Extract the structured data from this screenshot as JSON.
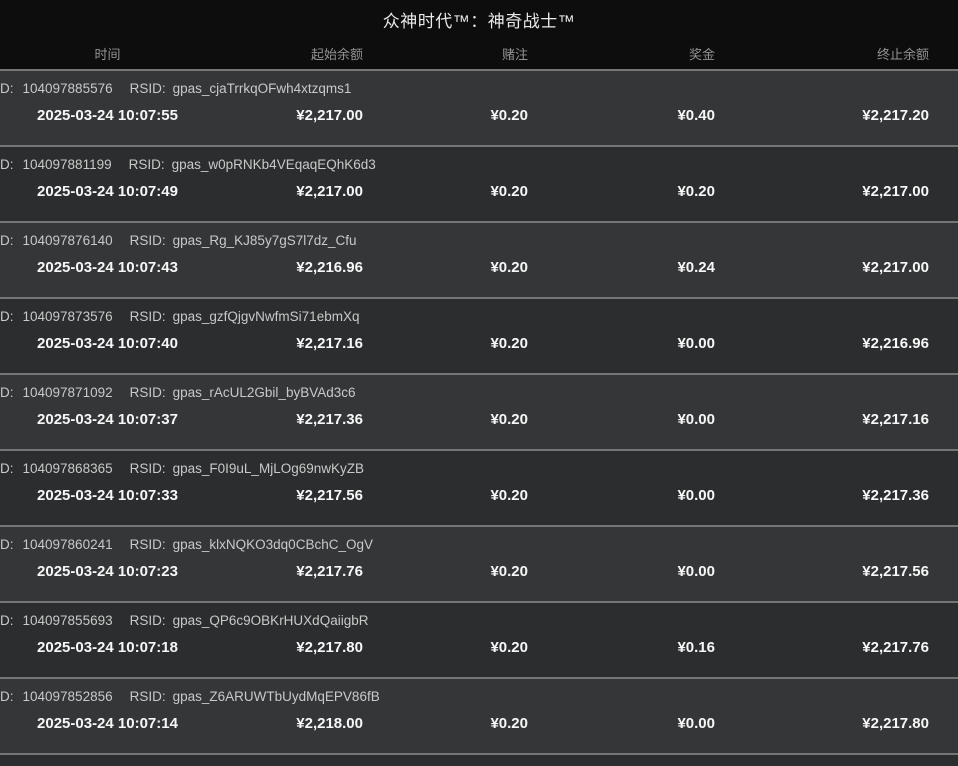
{
  "header": {
    "title": "众神时代™：神奇战士™",
    "columns": {
      "time": "时间",
      "start_balance": "起始余额",
      "bet": "赌注",
      "win": "奖金",
      "end_balance": "终止余额"
    }
  },
  "labels": {
    "id": "D:",
    "rsid": "RSID:"
  },
  "rows": [
    {
      "id": "104097885576",
      "rsid": "gpas_cjaTrrkqOFwh4xtzqms1",
      "time": "2025-03-24 10:07:55",
      "start": "¥2,217.00",
      "bet": "¥0.20",
      "win": "¥0.40",
      "end": "¥2,217.20"
    },
    {
      "id": "104097881199",
      "rsid": "gpas_w0pRNKb4VEqaqEQhK6d3",
      "time": "2025-03-24 10:07:49",
      "start": "¥2,217.00",
      "bet": "¥0.20",
      "win": "¥0.20",
      "end": "¥2,217.00"
    },
    {
      "id": "104097876140",
      "rsid": "gpas_Rg_KJ85y7gS7l7dz_Cfu",
      "time": "2025-03-24 10:07:43",
      "start": "¥2,216.96",
      "bet": "¥0.20",
      "win": "¥0.24",
      "end": "¥2,217.00"
    },
    {
      "id": "104097873576",
      "rsid": "gpas_gzfQjgvNwfmSi71ebmXq",
      "time": "2025-03-24 10:07:40",
      "start": "¥2,217.16",
      "bet": "¥0.20",
      "win": "¥0.00",
      "end": "¥2,216.96"
    },
    {
      "id": "104097871092",
      "rsid": "gpas_rAcUL2Gbil_byBVAd3c6",
      "time": "2025-03-24 10:07:37",
      "start": "¥2,217.36",
      "bet": "¥0.20",
      "win": "¥0.00",
      "end": "¥2,217.16"
    },
    {
      "id": "104097868365",
      "rsid": "gpas_F0I9uL_MjLOg69nwKyZB",
      "time": "2025-03-24 10:07:33",
      "start": "¥2,217.56",
      "bet": "¥0.20",
      "win": "¥0.00",
      "end": "¥2,217.36"
    },
    {
      "id": "104097860241",
      "rsid": "gpas_klxNQKO3dq0CBchC_OgV",
      "time": "2025-03-24 10:07:23",
      "start": "¥2,217.76",
      "bet": "¥0.20",
      "win": "¥0.00",
      "end": "¥2,217.56"
    },
    {
      "id": "104097855693",
      "rsid": "gpas_QP6c9OBKrHUXdQaiigbR",
      "time": "2025-03-24 10:07:18",
      "start": "¥2,217.80",
      "bet": "¥0.20",
      "win": "¥0.16",
      "end": "¥2,217.76"
    },
    {
      "id": "104097852856",
      "rsid": "gpas_Z6ARUWTbUydMqEPV86fB",
      "time": "2025-03-24 10:07:14",
      "start": "¥2,218.00",
      "bet": "¥0.20",
      "win": "¥0.00",
      "end": "¥2,217.80"
    }
  ],
  "colors": {
    "header_background": "#0d0d0d",
    "row_light": "#343638",
    "row_dark": "#2b2d2e",
    "separator": "#757575",
    "primary_text": "#f7f7f7",
    "secondary_text": "#c9c9c9",
    "column_header_text": "#929292"
  }
}
